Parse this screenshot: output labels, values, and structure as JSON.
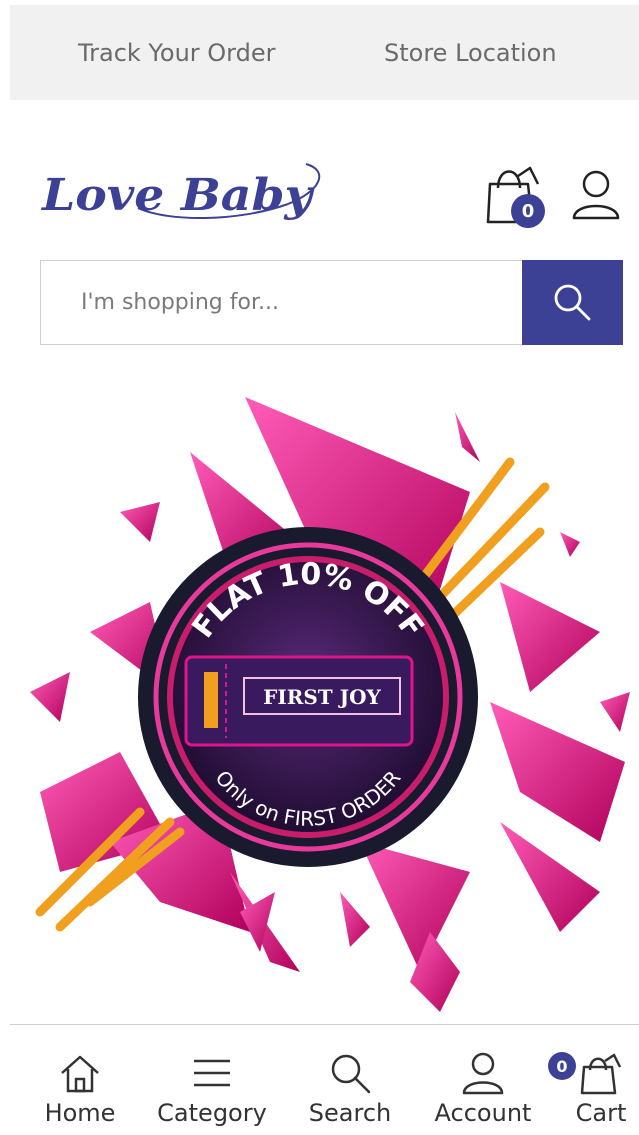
{
  "topbar": {
    "track_order": "Track Your Order",
    "store_location": "Store Location"
  },
  "header": {
    "logo_text": "Love Baby",
    "cart_count": "0",
    "icons": [
      "shopping-bag-icon",
      "user-icon"
    ]
  },
  "search": {
    "placeholder": "I'm shopping for...",
    "button_icon": "search-icon"
  },
  "banner": {
    "headline": "FLAT 10% OFF",
    "coupon_code": "FIRST JOY",
    "subline": "Only on FIRST ORDER",
    "colors": {
      "accent": "#e0147d",
      "ring": "#1a1a2e",
      "coupon_bg": "#3a1a5e"
    }
  },
  "bottom_nav": {
    "items": [
      {
        "label": "Home",
        "icon": "home-icon"
      },
      {
        "label": "Category",
        "icon": "menu-icon"
      },
      {
        "label": "Search",
        "icon": "search-icon"
      },
      {
        "label": "Account",
        "icon": "user-icon"
      },
      {
        "label": "Cart",
        "icon": "shopping-bag-icon"
      }
    ],
    "cart_count": "0"
  },
  "colors": {
    "brand": "#3d4196",
    "topbar_bg": "#f1f1f1",
    "border": "#cfcfcf"
  }
}
